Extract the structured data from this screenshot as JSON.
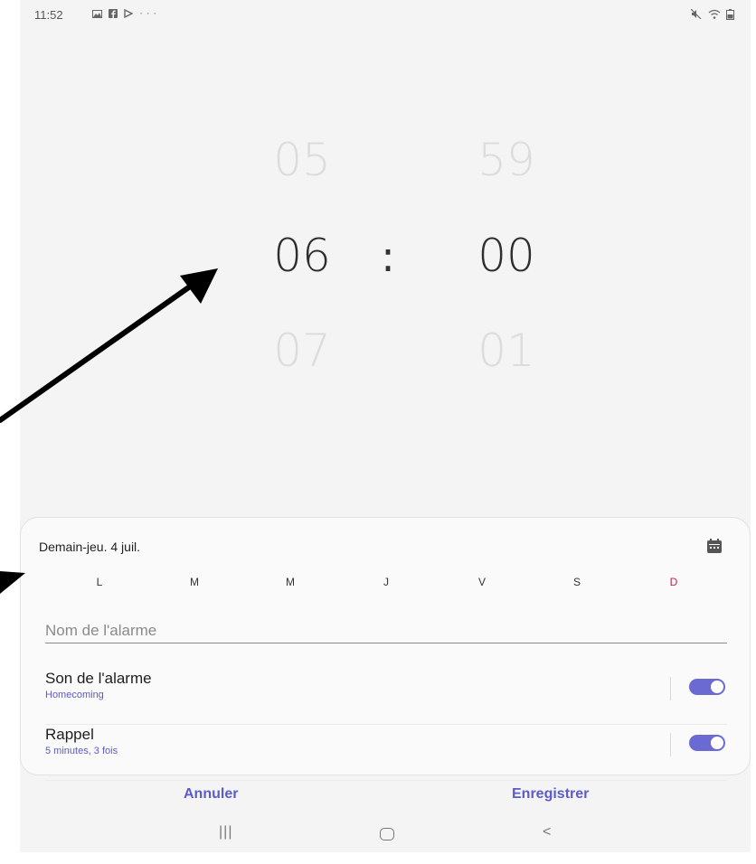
{
  "status_bar": {
    "time": "11:52",
    "left_icons": [
      "image-icon",
      "facebook-icon",
      "play-store-icon",
      "more-icon"
    ],
    "more_glyph": "···",
    "right_icons": [
      "mute-icon",
      "wifi-icon",
      "battery-icon"
    ]
  },
  "time_picker": {
    "hours": {
      "previous": "05",
      "current": "06",
      "next": "07"
    },
    "separator": ":",
    "minutes": {
      "previous": "59",
      "current": "00",
      "next": "01"
    }
  },
  "alarm_card": {
    "date_label": "Demain-jeu. 4 juil.",
    "days": [
      {
        "label": "L"
      },
      {
        "label": "M"
      },
      {
        "label": "M"
      },
      {
        "label": "J"
      },
      {
        "label": "V"
      },
      {
        "label": "S"
      },
      {
        "label": "D"
      }
    ],
    "sunday_color": "#c0244a",
    "name_placeholder": "Nom de l'alarme",
    "sound": {
      "title": "Son de l'alarme",
      "subtitle": "Homecoming",
      "enabled": true
    },
    "snooze": {
      "title": "Rappel",
      "subtitle": "5 minutes, 3 fois",
      "enabled": true
    }
  },
  "actions": {
    "cancel": "Annuler",
    "save": "Enregistrer"
  },
  "nav_bar": {
    "recents": "|||",
    "back": "<"
  },
  "colors": {
    "accent": "#5c5bc9",
    "toggle": "#6b6ad2",
    "background": "#f4f4f4"
  }
}
